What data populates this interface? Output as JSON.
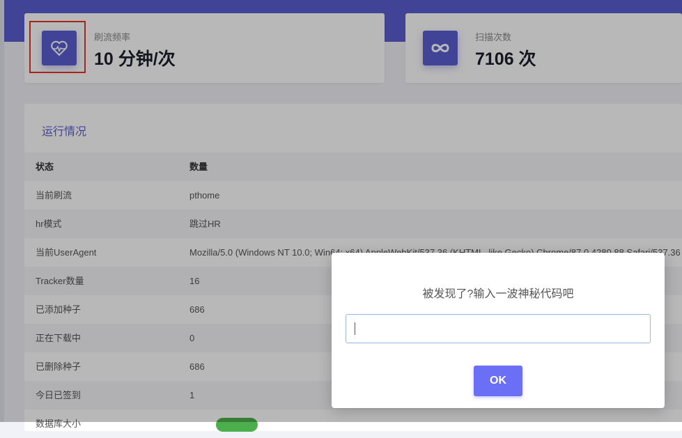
{
  "stats": [
    {
      "label": "刷流频率",
      "value": "10 分钟/次",
      "icon": "heartbeat-icon"
    },
    {
      "label": "扫描次数",
      "value": "7106 次",
      "icon": "infinity-icon"
    }
  ],
  "panel": {
    "title": "运行情况",
    "headers": [
      "状态",
      "数量"
    ],
    "rows": [
      [
        "当前刷流",
        "pthome"
      ],
      [
        "hr模式",
        "跳过HR"
      ],
      [
        "当前UserAgent",
        "Mozilla/5.0 (Windows NT 10.0; Win64; x64) AppleWebKit/537.36 (KHTML, like Gecko) Chrome/87.0.4280.88 Safari/537.36"
      ],
      [
        "Tracker数量",
        "16"
      ],
      [
        "已添加种子",
        "686"
      ],
      [
        "正在下载中",
        "0"
      ],
      [
        "已删除种子",
        "686"
      ],
      [
        "今日已签到",
        "1"
      ],
      [
        "数据库大小",
        ""
      ]
    ]
  },
  "dialog": {
    "title": "被发现了?输入一波神秘代码吧",
    "input_value": "",
    "ok_label": "OK"
  },
  "colors": {
    "accent": "#5b5fd0",
    "ok_button": "#6b6ff5",
    "highlight": "#e5332a"
  }
}
